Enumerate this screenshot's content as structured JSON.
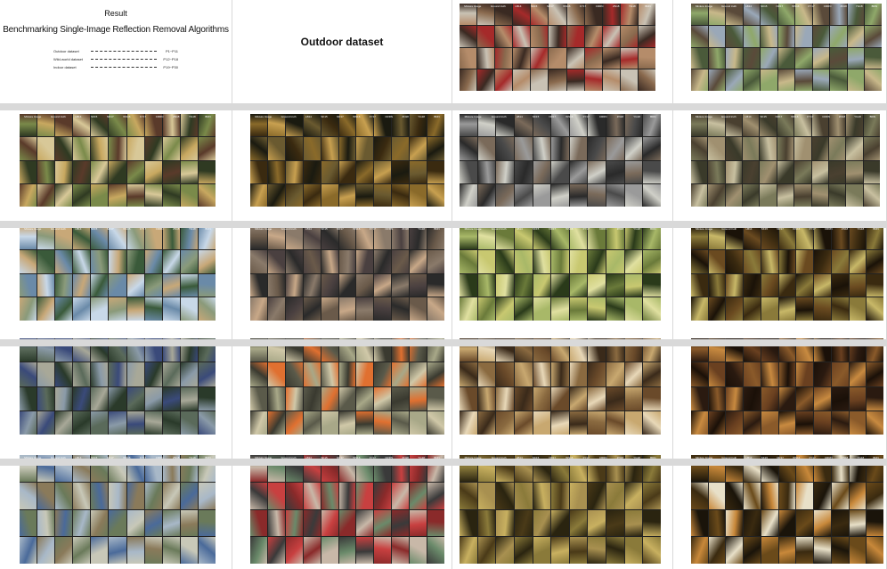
{
  "poster": {
    "result_label": "Result",
    "title": "Benchmarking Single-Image Reflection Removal Algorithms",
    "legend": [
      {
        "name": "Outdoor dataset",
        "value": "P1~P11"
      },
      {
        "name": "Wild-world dataset",
        "value": "P12~P18"
      },
      {
        "name": "Indoor dataset",
        "value": "P19~P30"
      }
    ],
    "section_label": "Outdoor dataset"
  },
  "thumbnail_panels": {
    "column_headers": [
      "Mixture Image",
      "Ground truth",
      "LB14",
      "SK15",
      "NR17",
      "WS16",
      "FY17",
      "CRRN",
      "ZN18",
      "YG18",
      "BDN"
    ],
    "panels": [
      {
        "id": "p1",
        "palette": [
          "#b58c6a",
          "#c9c2b4",
          "#8a6a4e",
          "#3a2a22",
          "#a52a2a"
        ]
      },
      {
        "id": "p2",
        "palette": [
          "#4a5a3a",
          "#8fa86a",
          "#c8b88a",
          "#5a4a3a",
          "#9aa8b8"
        ]
      },
      {
        "id": "p3",
        "palette": [
          "#2f3a22",
          "#7a8a4a",
          "#c8a860",
          "#5a3a2a",
          "#d8c898"
        ]
      },
      {
        "id": "p4",
        "palette": [
          "#3a2a10",
          "#8a6a2a",
          "#c8a050",
          "#1a1a10",
          "#6a5a30"
        ]
      },
      {
        "id": "p5",
        "palette": [
          "#4a4a4a",
          "#9a9a9a",
          "#d0d0c8",
          "#2a2a2a",
          "#7a6a5a"
        ]
      },
      {
        "id": "p6",
        "palette": [
          "#3a3a2a",
          "#7a7a5a",
          "#c8c0a0",
          "#4a4030",
          "#a09070"
        ]
      },
      {
        "id": "p7",
        "palette": [
          "#6a8aa8",
          "#c8d8e8",
          "#8a9a7a",
          "#c8a878",
          "#3a5a3a"
        ]
      },
      {
        "id": "p8",
        "palette": [
          "#2a2a2a",
          "#6a5a4a",
          "#c8a888",
          "#8a7a6a",
          "#4a4040"
        ]
      },
      {
        "id": "p9",
        "palette": [
          "#2a3a1a",
          "#a8b868",
          "#e0e0a0",
          "#6a7a3a",
          "#c8c870"
        ]
      },
      {
        "id": "p10",
        "palette": [
          "#3a2a10",
          "#8a7a3a",
          "#c8b868",
          "#1a1208",
          "#6a4a20"
        ]
      },
      {
        "id": "p11",
        "palette": [
          "#2a3a2a",
          "#5a6a5a",
          "#8a9aa8",
          "#3a4a7a",
          "#a8a898"
        ]
      },
      {
        "id": "p12",
        "palette": [
          "#5a5a4a",
          "#a8a888",
          "#d0c8a8",
          "#3a3a30",
          "#e07030"
        ]
      },
      {
        "id": "p13",
        "palette": [
          "#6a4a2a",
          "#c8a870",
          "#e8d8b8",
          "#3a2a1a",
          "#8a6a40"
        ]
      },
      {
        "id": "p14",
        "palette": [
          "#2a1a10",
          "#8a5a2a",
          "#c88a40",
          "#1a1008",
          "#6a4020"
        ]
      },
      {
        "id": "p15",
        "palette": [
          "#6a7a5a",
          "#c8c8b8",
          "#4a6a9a",
          "#a8b8c8",
          "#8a7a5a"
        ]
      },
      {
        "id": "p16",
        "palette": [
          "#8a2a2a",
          "#c8b8a8",
          "#6a8a6a",
          "#3a3a3a",
          "#c84040"
        ]
      },
      {
        "id": "p17",
        "palette": [
          "#2a2410",
          "#8a7a3a",
          "#c8b060",
          "#4a3a18",
          "#a89050"
        ]
      },
      {
        "id": "p18",
        "palette": [
          "#1a140a",
          "#6a4a1a",
          "#c8883a",
          "#3a2a10",
          "#e8e0c8"
        ]
      }
    ]
  }
}
